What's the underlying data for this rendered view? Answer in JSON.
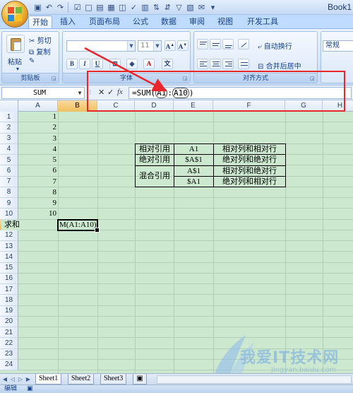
{
  "window": {
    "title": "Book1"
  },
  "quick_access": {
    "items": [
      "save-icon",
      "undo-icon",
      "redo-icon",
      "checkbox-icon",
      "new-icon",
      "open-icon",
      "print-icon",
      "preview-icon",
      "spelling-icon",
      "sort-icon"
    ]
  },
  "tabs": [
    {
      "label": "开始",
      "active": true
    },
    {
      "label": "插入",
      "active": false
    },
    {
      "label": "页面布局",
      "active": false
    },
    {
      "label": "公式",
      "active": false
    },
    {
      "label": "数据",
      "active": false
    },
    {
      "label": "审阅",
      "active": false
    },
    {
      "label": "视图",
      "active": false
    },
    {
      "label": "开发工具",
      "active": false
    }
  ],
  "ribbon": {
    "clipboard": {
      "paste": "粘贴",
      "cut": "剪切",
      "copy": "复制",
      "label": "剪贴板"
    },
    "font": {
      "font_size": "11",
      "label": "字体",
      "bold": "B",
      "italic": "I",
      "underline": "U"
    },
    "alignment": {
      "wrap": "自动换行",
      "merge": "合并后居中",
      "label": "对齐方式"
    },
    "number": {
      "format": "常规"
    }
  },
  "formula_bar": {
    "name_box": "SUM",
    "formula_prefix": "=SUM(",
    "ref1": "A1",
    "sep": ":",
    "ref2": "A10",
    "formula_suffix": ")"
  },
  "grid": {
    "columns": [
      "A",
      "B",
      "C",
      "D",
      "E",
      "F",
      "G",
      "H"
    ],
    "rows": [
      "1",
      "2",
      "3",
      "4",
      "5",
      "6",
      "7",
      "8",
      "9",
      "10",
      "11",
      "12",
      "13",
      "14",
      "15",
      "16",
      "17",
      "18",
      "19",
      "20",
      "21",
      "22",
      "23",
      "24"
    ],
    "selected_column": "B",
    "selected_row": "11",
    "col_a_values": [
      "1",
      "2",
      "3",
      "4",
      "5",
      "6",
      "7",
      "8",
      "9",
      "10"
    ],
    "a11": "求和",
    "b11": "M(A1:A10)"
  },
  "ref_table": {
    "r1": [
      "相对引用",
      "A1",
      "相对列和相对行"
    ],
    "r2": [
      "绝对引用",
      "$A$1",
      "绝对列和绝对行"
    ],
    "merged": "混合引用",
    "r3": [
      "A$1",
      "相对列和绝对行"
    ],
    "r4": [
      "$A1",
      "绝对列和相对行"
    ]
  },
  "sheets": [
    {
      "label": "Sheet1",
      "active": true
    },
    {
      "label": "Sheet2",
      "active": false
    },
    {
      "label": "Sheet3",
      "active": false
    }
  ],
  "status": {
    "mode": "编辑"
  },
  "watermark": {
    "text": "我爱IT技术网",
    "sub": "jingyan.baidu.com"
  },
  "colors": {
    "grid_bg": "#cce8cf",
    "annotation": "#e8262b",
    "ribbon": "#d7e6f9"
  }
}
